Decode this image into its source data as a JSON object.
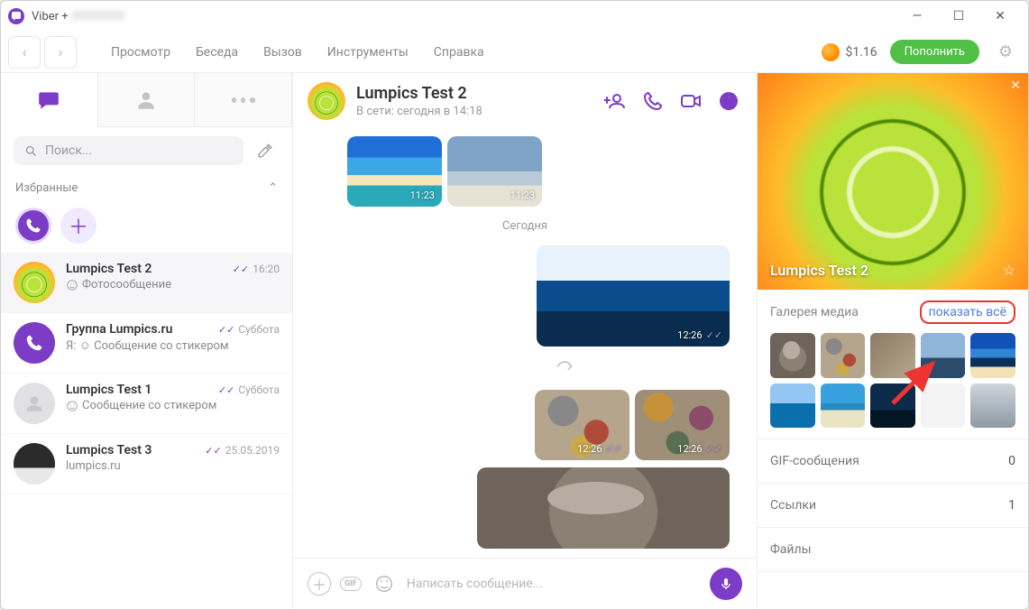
{
  "window": {
    "title": "Viber +"
  },
  "menubar": {
    "items": [
      "Просмотр",
      "Беседа",
      "Вызов",
      "Инструменты",
      "Справка"
    ],
    "balance": "$1.16",
    "topup": "Пополнить"
  },
  "sidebar": {
    "search_placeholder": "Поиск...",
    "favorites_label": "Избранные",
    "chats": [
      {
        "name": "Lumpics Test 2",
        "subtitle": "Фотосообщение",
        "time": "16:20",
        "checks": true,
        "avatar": "orange",
        "smiley": true,
        "active": true
      },
      {
        "name": "Группа Lumpics.ru",
        "subtitle": "Я: ☺ Сообщение со стикером",
        "time": "Суббота",
        "checks": true,
        "avatar": "viber",
        "smiley": false,
        "active": false
      },
      {
        "name": "Lumpics Test 1",
        "subtitle": "Сообщение со стикером",
        "time": "Суббота",
        "checks": true,
        "avatar": "grey",
        "smiley": true,
        "active": false
      },
      {
        "name": "Lumpics Test 3",
        "subtitle": "lumpics.ru",
        "time": "25.05.2019",
        "checks": true,
        "avatar": "laptop",
        "smiley": false,
        "active": false
      }
    ]
  },
  "chat": {
    "title": "Lumpics Test 2",
    "status": "В сети: сегодня в 14:18",
    "date_separator": "Сегодня",
    "msg_times": {
      "t1": "11:23",
      "t2": "11:23",
      "t3": "12:26",
      "t4": "12:26",
      "t5": "12:26"
    },
    "composer_placeholder": "Написать сообщение..."
  },
  "info": {
    "name": "Lumpics Test 2",
    "gallery_label": "Галерея медиа",
    "show_all": "показать всё",
    "rows": [
      {
        "label": "GIF-сообщения",
        "val": "0"
      },
      {
        "label": "Ссылки",
        "val": "1"
      },
      {
        "label": "Файлы",
        "val": ""
      }
    ]
  }
}
